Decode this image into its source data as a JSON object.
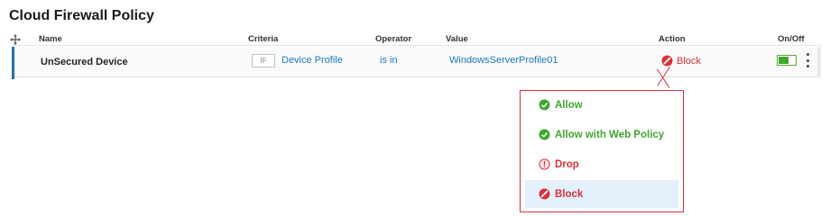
{
  "page": {
    "title": "Cloud Firewall Policy"
  },
  "columns": {
    "name": "Name",
    "criteria": "Criteria",
    "operator": "Operator",
    "value": "Value",
    "action": "Action",
    "onoff": "On/Off"
  },
  "rule": {
    "name": "UnSecured Device",
    "condition_badge": "IF",
    "criteria": "Device Profile",
    "operator": "is in",
    "value": "WindowsServerProfile01",
    "action": "Block",
    "enabled": true
  },
  "action_menu": {
    "options": [
      {
        "label": "Allow",
        "icon": "check-circle-icon",
        "color": "#3fa72e"
      },
      {
        "label": "Allow with Web Policy",
        "icon": "check-circle-icon",
        "color": "#3fa72e"
      },
      {
        "label": "Drop",
        "icon": "exclamation-circle-icon",
        "color": "#d9323c"
      },
      {
        "label": "Block",
        "icon": "block-icon",
        "color": "#d9323c",
        "selected": true
      }
    ]
  },
  "colors": {
    "accent": "#1f6fb3",
    "link": "#1f78c1",
    "success": "#3fa72e",
    "danger": "#d9323c",
    "selected_bg": "#e4f0fb"
  }
}
